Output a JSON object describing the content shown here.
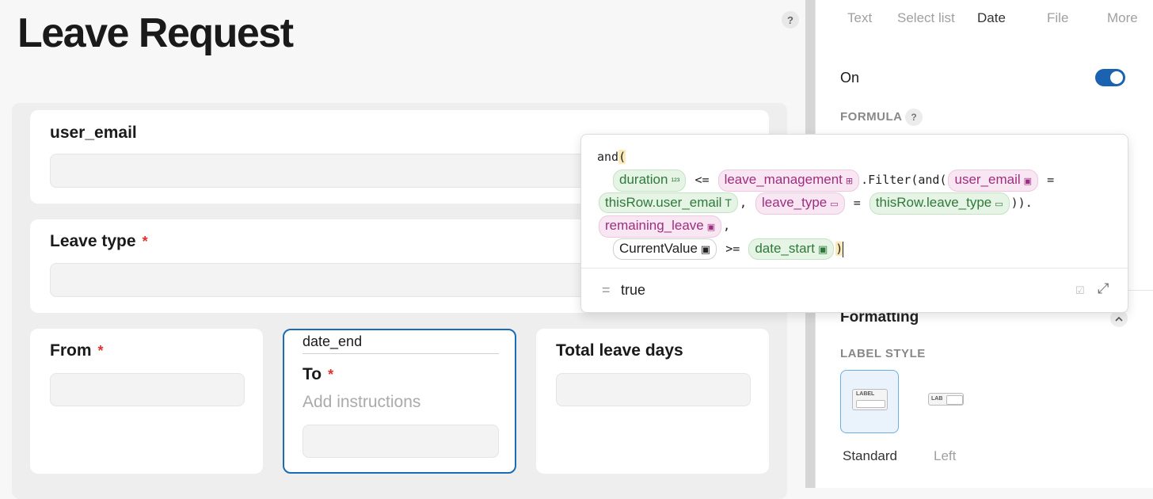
{
  "page": {
    "title": "Leave Request",
    "help": "?"
  },
  "form": {
    "fields": [
      {
        "label": "user_email",
        "required": false
      },
      {
        "label": "Leave type",
        "required": true,
        "req_mark": "*"
      },
      {
        "label": "From",
        "required": true,
        "req_mark": "*"
      },
      {
        "label": "To",
        "required": true,
        "req_mark": "*",
        "field_name": "date_end",
        "instructions_placeholder": "Add instructions"
      },
      {
        "label": "Total leave days",
        "required": false
      }
    ]
  },
  "sidebar": {
    "tabs": [
      {
        "label": "Text",
        "active": false
      },
      {
        "label": "Select list",
        "active": false
      },
      {
        "label": "Date",
        "active": true
      },
      {
        "label": "File",
        "active": false
      },
      {
        "label": "More",
        "active": false
      }
    ],
    "toggle_label": "On",
    "toggle_on": true,
    "formula_label": "FORMULA",
    "formula_help": "?",
    "formatting_label": "Formatting",
    "label_style_label": "LABEL STYLE",
    "label_style_options": [
      {
        "label": "Standard",
        "selected": true,
        "mini_text": "LABEL"
      },
      {
        "label": "Left",
        "selected": false,
        "mini_text": "LAB"
      }
    ]
  },
  "formula_popover": {
    "line1": {
      "fn": "and",
      "paren": "("
    },
    "line2": {
      "chip_duration": "duration",
      "op1": " <= ",
      "chip_table": "leave_management",
      "filter_open": ".Filter(and(",
      "chip_user_email": "user_email",
      "op2": " ="
    },
    "line3": {
      "chip_this_email": "thisRow.user_email",
      "comma": ",",
      "chip_leave_type": "leave_type",
      "op": " = ",
      "chip_this_leave_type": "thisRow.leave_type",
      "close": ")). "
    },
    "line4": {
      "chip_remaining": "remaining_leave",
      "comma": ","
    },
    "line5": {
      "chip_current": "CurrentValue",
      "op": " >= ",
      "chip_date_start": "date_start",
      "close": ")"
    },
    "result_eq": "=",
    "result": "true"
  },
  "colors": {
    "accent": "#1b62b1",
    "chip_green": "#2f7a3a",
    "chip_pink": "#9d2f80"
  }
}
